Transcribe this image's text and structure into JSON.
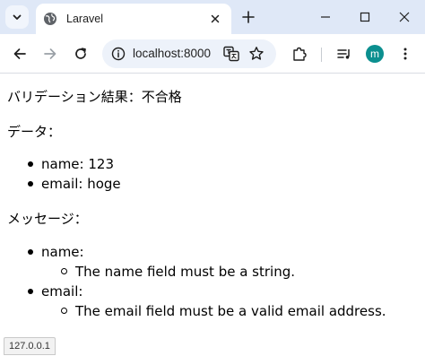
{
  "browser": {
    "tab_title": "Laravel",
    "url": "localhost:8000",
    "profile_initial": "m"
  },
  "page": {
    "result_line": "バリデーション結果：不合格",
    "data_heading": "データ：",
    "data_items": [
      {
        "text": "name: 123"
      },
      {
        "text": "email: hoge"
      }
    ],
    "messages_heading": "メッセージ：",
    "message_groups": [
      {
        "field": "name:",
        "message": "The name field must be a string."
      },
      {
        "field": "email:",
        "message": "The email field must be a valid email address."
      }
    ]
  },
  "status_bar": {
    "text": "127.0.0.1"
  },
  "colors": {
    "tabstrip": "#dfe8f7",
    "omnibox": "#edf2fa",
    "avatar": "#0b8f8f"
  }
}
